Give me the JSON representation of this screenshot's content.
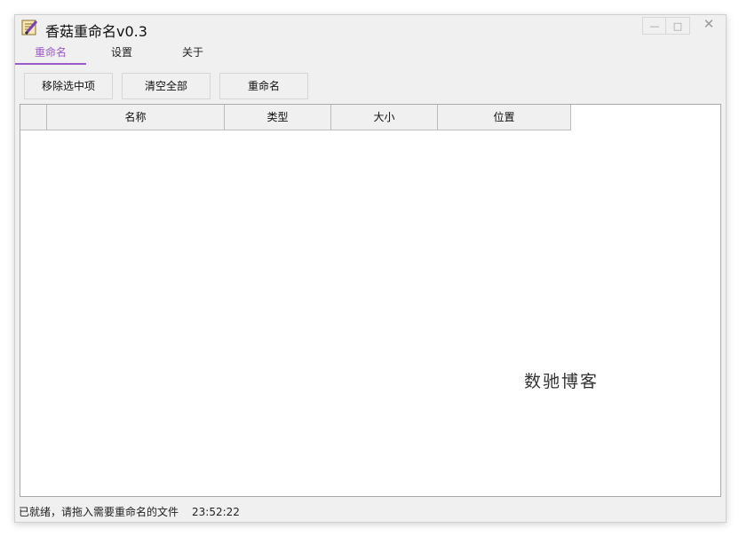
{
  "window": {
    "title": "香菇重命名v0.3",
    "icon": "notepad-pencil-icon",
    "controls": {
      "minimize": "—",
      "maximize": "□",
      "close": "✕"
    }
  },
  "tabs": [
    {
      "label": "重命名",
      "active": true
    },
    {
      "label": "设置",
      "active": false
    },
    {
      "label": "关于",
      "active": false
    }
  ],
  "toolbar": {
    "remove_selected": "移除选中项",
    "clear_all": "清空全部",
    "rename": "重命名"
  },
  "table": {
    "columns": [
      "",
      "名称",
      "类型",
      "大小",
      "位置"
    ],
    "rows": []
  },
  "watermark": "数驰博客",
  "status": {
    "message": "已就绪，请拖入需要重命名的文件",
    "time": "23:52:22"
  },
  "colors": {
    "accent": "#9b59c9",
    "background": "#f0f0f0",
    "grid_bg": "#ffffff"
  }
}
